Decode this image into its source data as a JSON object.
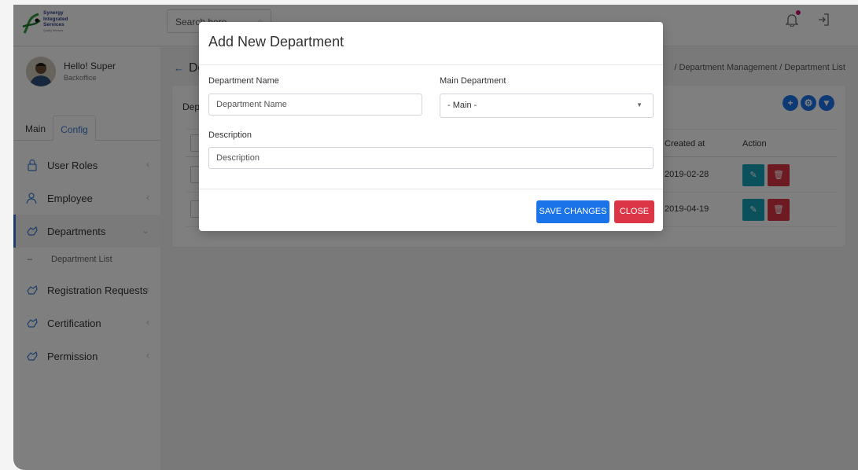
{
  "brand": {
    "logo_lines": [
      "Synergy",
      "Integrated",
      "Services"
    ],
    "tagline": "Quality Services"
  },
  "topbar": {
    "search_placeholder": "Search here..."
  },
  "sidebar": {
    "profile": {
      "greeting": "Hello! Super",
      "role": "Backoffice"
    },
    "tabs": [
      {
        "label": "Main"
      },
      {
        "label": "Config"
      }
    ],
    "items": [
      {
        "label": "User Roles",
        "icon": "lock-icon"
      },
      {
        "label": "Employee",
        "icon": "users-icon"
      },
      {
        "label": "Departments",
        "icon": "hand-icon"
      },
      {
        "label": "Registration Requests",
        "icon": "hand-icon"
      },
      {
        "label": "Certification",
        "icon": "hand-icon"
      },
      {
        "label": "Permission",
        "icon": "hand-icon"
      }
    ],
    "subitems": [
      {
        "label": "Department List"
      }
    ]
  },
  "content": {
    "page_title": "De",
    "breadcrumb": "/ Department Management / Department List",
    "card_title": "Dep",
    "table": {
      "headers": [
        "Created at",
        "Action"
      ],
      "rows": [
        {
          "created_at": "2019-02-28"
        },
        {
          "created_at": "2019-04-19"
        }
      ]
    }
  },
  "modal": {
    "title": "Add New Department",
    "department_name": {
      "label": "Department Name",
      "placeholder": "Department Name",
      "value": ""
    },
    "main_department": {
      "label": "Main Department",
      "selected": "- Main -"
    },
    "description": {
      "label": "Description",
      "placeholder": "Description",
      "value": ""
    },
    "buttons": {
      "save": "Save changes",
      "close": "Close"
    }
  },
  "colors": {
    "primary": "#1a73e8",
    "danger": "#dc3545",
    "info": "#17a2b8",
    "notification_dot": "#c3107a"
  }
}
